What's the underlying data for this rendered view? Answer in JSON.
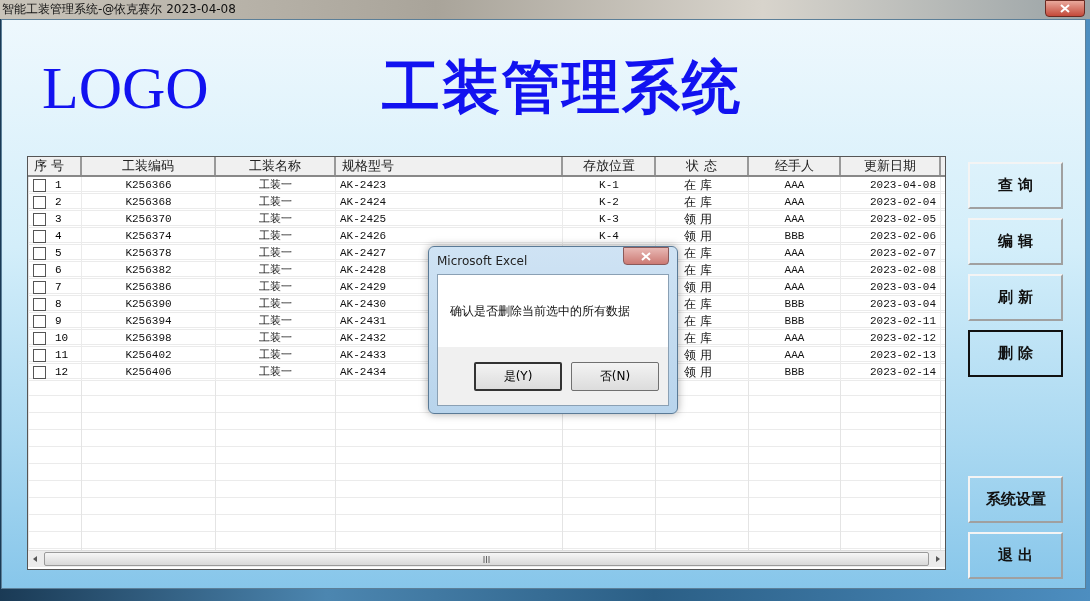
{
  "window": {
    "title": "智能工装管理系统-@依克赛尔 2023-04-08"
  },
  "header": {
    "logo": "LOGO",
    "title": "工装管理系统"
  },
  "table": {
    "columns": [
      "序 号",
      "工装编码",
      "工装名称",
      "规格型号",
      "存放位置",
      "状 态",
      "经手人",
      "更新日期"
    ],
    "rows": [
      {
        "checked": false,
        "no": "1",
        "code": "K256366",
        "name": "工装一",
        "spec": "AK-2423",
        "location": "K-1",
        "status": "在 库",
        "handler": "AAA",
        "date": "2023-04-08"
      },
      {
        "checked": false,
        "no": "2",
        "code": "K256368",
        "name": "工装一",
        "spec": "AK-2424",
        "location": "K-2",
        "status": "在 库",
        "handler": "AAA",
        "date": "2023-02-04"
      },
      {
        "checked": false,
        "no": "3",
        "code": "K256370",
        "name": "工装一",
        "spec": "AK-2425",
        "location": "K-3",
        "status": "领 用",
        "handler": "AAA",
        "date": "2023-02-05"
      },
      {
        "checked": false,
        "no": "4",
        "code": "K256374",
        "name": "工装一",
        "spec": "AK-2426",
        "location": "K-4",
        "status": "领 用",
        "handler": "BBB",
        "date": "2023-02-06"
      },
      {
        "checked": false,
        "no": "5",
        "code": "K256378",
        "name": "工装一",
        "spec": "AK-2427",
        "status": "在 库",
        "handler": "AAA",
        "date": "2023-02-07"
      },
      {
        "checked": false,
        "no": "6",
        "code": "K256382",
        "name": "工装一",
        "spec": "AK-2428",
        "status": "在 库",
        "handler": "AAA",
        "date": "2023-02-08"
      },
      {
        "checked": false,
        "no": "7",
        "code": "K256386",
        "name": "工装一",
        "spec": "AK-2429",
        "status": "领 用",
        "handler": "AAA",
        "date": "2023-03-04"
      },
      {
        "checked": false,
        "no": "8",
        "code": "K256390",
        "name": "工装一",
        "spec": "AK-2430",
        "status": "在 库",
        "handler": "BBB",
        "date": "2023-03-04"
      },
      {
        "checked": false,
        "no": "9",
        "code": "K256394",
        "name": "工装一",
        "spec": "AK-2431",
        "status": "在 库",
        "handler": "BBB",
        "date": "2023-02-11"
      },
      {
        "checked": false,
        "no": "10",
        "code": "K256398",
        "name": "工装一",
        "spec": "AK-2432",
        "status": "在 库",
        "handler": "AAA",
        "date": "2023-02-12"
      },
      {
        "checked": false,
        "no": "11",
        "code": "K256402",
        "name": "工装一",
        "spec": "AK-2433",
        "status": "领 用",
        "handler": "AAA",
        "date": "2023-02-13"
      },
      {
        "checked": false,
        "no": "12",
        "code": "K256406",
        "name": "工装一",
        "spec": "AK-2434",
        "status": "领 用",
        "handler": "BBB",
        "date": "2023-02-14"
      }
    ]
  },
  "side_buttons": [
    {
      "label": "查 询",
      "focused": false
    },
    {
      "label": "编 辑",
      "focused": false
    },
    {
      "label": "刷 新",
      "focused": false
    },
    {
      "label": "删 除",
      "focused": true
    },
    {
      "label": "系统设置",
      "focused": false
    },
    {
      "label": "退 出",
      "focused": false
    }
  ],
  "dialog": {
    "title": "Microsoft Excel",
    "message": "确认是否删除当前选中的所有数据",
    "buttons": [
      {
        "label": "是(Y)",
        "focused": true
      },
      {
        "label": "否(N)",
        "focused": false
      }
    ]
  }
}
